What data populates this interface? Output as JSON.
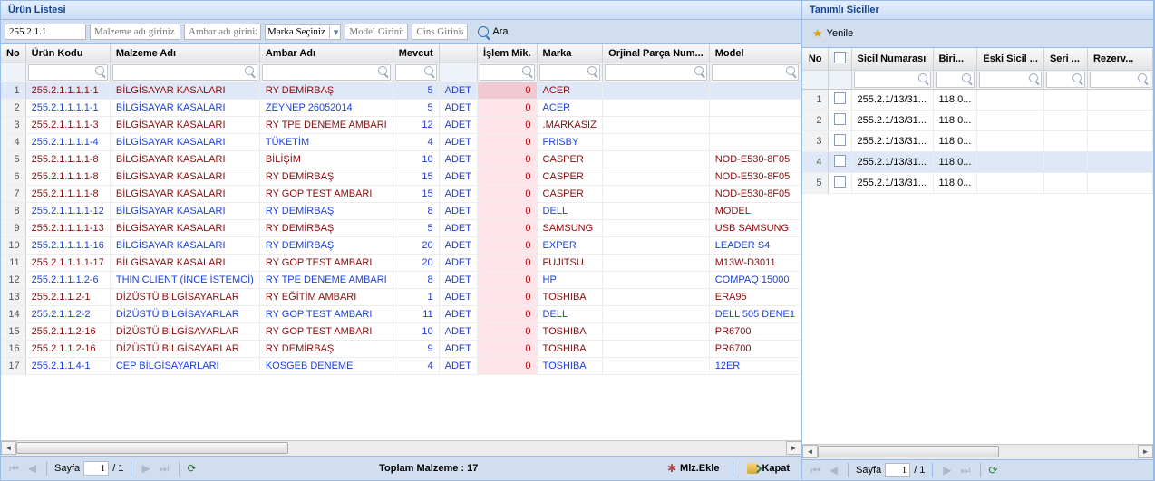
{
  "left": {
    "title": "Ürün Listesi",
    "search": {
      "kodu_value": "255.2.1.1",
      "malzeme_ph": "Malzeme adı giriniz",
      "ambar_ph": "Ambar adı giriniz",
      "marka_ph": "Marka Seçiniz",
      "model_ph": "Model Giriniz",
      "cins_ph": "Cins Giriniz",
      "ara": "Ara"
    },
    "cols": {
      "no": "No",
      "kodu": "Ürün Kodu",
      "malzeme": "Malzeme Adı",
      "ambar": "Ambar Adı",
      "mevcut": "Mevcut",
      "unit": "",
      "islem": "İşlem Mik.",
      "marka": "Marka",
      "orjinal": "Orjinal Parça Num...",
      "model": "Model"
    },
    "rows": [
      {
        "n": 1,
        "k": "255.2.1.1.1.1-1",
        "m": "BİLGİSAYAR KASALARI",
        "a": "RY DEMİRBAŞ",
        "q": 5,
        "u": "ADET",
        "i": 0,
        "marka": "ACER",
        "model": "",
        "sel": true,
        "dr": [
          "k",
          "m",
          "a",
          "marka"
        ]
      },
      {
        "n": 2,
        "k": "255.2.1.1.1.1-1",
        "m": "BİLGİSAYAR KASALARI",
        "a": "ZEYNEP 26052014",
        "q": 5,
        "u": "ADET",
        "i": 0,
        "marka": "ACER",
        "model": ""
      },
      {
        "n": 3,
        "k": "255.2.1.1.1.1-3",
        "m": "BİLGİSAYAR KASALARI",
        "a": "RY TPE DENEME AMBARI",
        "q": 12,
        "u": "ADET",
        "i": 0,
        "marka": ".MARKASIZ",
        "model": "",
        "dr": [
          "k",
          "m",
          "a",
          "marka"
        ]
      },
      {
        "n": 4,
        "k": "255.2.1.1.1.1-4",
        "m": "BİLGİSAYAR KASALARI",
        "a": "TÜKETİM",
        "q": 4,
        "u": "ADET",
        "i": 0,
        "marka": "FRISBY",
        "model": ""
      },
      {
        "n": 5,
        "k": "255.2.1.1.1.1-8",
        "m": "BİLGİSAYAR KASALARI",
        "a": "BİLİŞİM",
        "q": 10,
        "u": "ADET",
        "i": 0,
        "marka": "CASPER",
        "model": "NOD-E530-8F05",
        "dr": [
          "k",
          "m",
          "a",
          "marka",
          "model"
        ]
      },
      {
        "n": 6,
        "k": "255.2.1.1.1.1-8",
        "m": "BİLGİSAYAR KASALARI",
        "a": "RY DEMİRBAŞ",
        "q": 15,
        "u": "ADET",
        "i": 0,
        "marka": "CASPER",
        "model": "NOD-E530-8F05",
        "dr": [
          "k",
          "m",
          "a",
          "marka",
          "model"
        ]
      },
      {
        "n": 7,
        "k": "255.2.1.1.1.1-8",
        "m": "BİLGİSAYAR KASALARI",
        "a": "RY GOP TEST AMBARI",
        "q": 15,
        "u": "ADET",
        "i": 0,
        "marka": "CASPER",
        "model": "NOD-E530-8F05",
        "dr": [
          "k",
          "m",
          "a",
          "marka",
          "model"
        ]
      },
      {
        "n": 8,
        "k": "255.2.1.1.1.1-12",
        "m": "BİLGİSAYAR KASALARI",
        "a": "RY DEMİRBAŞ",
        "q": 8,
        "u": "ADET",
        "i": 0,
        "marka": "DELL",
        "model": "MODEL",
        "dr": [
          "model"
        ]
      },
      {
        "n": 9,
        "k": "255.2.1.1.1.1-13",
        "m": "BİLGİSAYAR KASALARI",
        "a": "RY DEMİRBAŞ",
        "q": 5,
        "u": "ADET",
        "i": 0,
        "marka": "SAMSUNG",
        "model": "USB SAMSUNG",
        "dr": [
          "k",
          "m",
          "a",
          "marka",
          "model"
        ]
      },
      {
        "n": 10,
        "k": "255.2.1.1.1.1-16",
        "m": "BİLGİSAYAR KASALARI",
        "a": "RY DEMİRBAŞ",
        "q": 20,
        "u": "ADET",
        "i": 0,
        "marka": "EXPER",
        "model": "LEADER S4"
      },
      {
        "n": 11,
        "k": "255.2.1.1.1.1-17",
        "m": "BİLGİSAYAR KASALARI",
        "a": "RY GOP TEST AMBARI",
        "q": 20,
        "u": "ADET",
        "i": 0,
        "marka": "FUJITSU",
        "model": "M13W-D3011",
        "dr": [
          "k",
          "m",
          "a",
          "marka",
          "model"
        ]
      },
      {
        "n": 12,
        "k": "255.2.1.1.1.2-6",
        "m": "THIN CLIENT (İNCE İSTEMCİ)",
        "a": "RY TPE DENEME AMBARI",
        "q": 8,
        "u": "ADET",
        "i": 0,
        "marka": "HP",
        "model": "COMPAQ 15000"
      },
      {
        "n": 13,
        "k": "255.2.1.1.2-1",
        "m": "DİZÜSTÜ BİLGİSAYARLAR",
        "a": "RY EĞİTİM AMBARI",
        "q": 1,
        "u": "ADET",
        "i": 0,
        "marka": "TOSHIBA",
        "model": "ERA95",
        "dr": [
          "k",
          "m",
          "a",
          "marka",
          "model"
        ]
      },
      {
        "n": 14,
        "k": "255.2.1.1.2-2",
        "m": "DİZÜSTÜ BİLGİSAYARLAR",
        "a": "RY GOP TEST AMBARI",
        "q": 11,
        "u": "ADET",
        "i": 0,
        "marka": "DELL",
        "model": "DELL 505 DENE1"
      },
      {
        "n": 15,
        "k": "255.2.1.1.2-16",
        "m": "DİZÜSTÜ BİLGİSAYARLAR",
        "a": "RY GOP TEST AMBARI",
        "q": 10,
        "u": "ADET",
        "i": 0,
        "marka": "TOSHIBA",
        "model": "PR6700",
        "dr": [
          "k",
          "m",
          "a",
          "marka",
          "model"
        ]
      },
      {
        "n": 16,
        "k": "255.2.1.1.2-16",
        "m": "DİZÜSTÜ BİLGİSAYARLAR",
        "a": "RY DEMİRBAŞ",
        "q": 9,
        "u": "ADET",
        "i": 0,
        "marka": "TOSHIBA",
        "model": "PR6700",
        "dr": [
          "k",
          "m",
          "a",
          "marka",
          "model"
        ]
      },
      {
        "n": 17,
        "k": "255.2.1.1.4-1",
        "m": "CEP BİLGİSAYARLARI",
        "a": "KOSGEB DENEME",
        "q": 4,
        "u": "ADET",
        "i": 0,
        "marka": "TOSHIBA",
        "model": "12ER"
      }
    ],
    "footer": {
      "sayfa": "Sayfa",
      "page": "1",
      "total": "/ 1",
      "toplam": "Toplam Malzeme : 17",
      "mlz": "Mlz.Ekle",
      "kapat": "Kapat"
    }
  },
  "right": {
    "title": "Tanımlı Siciller",
    "yenile": "Yenile",
    "cols": {
      "no": "No",
      "chk": "",
      "sicil": "Sicil Numarası",
      "birim": "Biri...",
      "eski": "Eski Sicil ...",
      "seri": "Seri ...",
      "rezerv": "Rezerv..."
    },
    "rows": [
      {
        "n": 1,
        "s": "255.2.1/13/31...",
        "b": "118.0..."
      },
      {
        "n": 2,
        "s": "255.2.1/13/31...",
        "b": "118.0..."
      },
      {
        "n": 3,
        "s": "255.2.1/13/31...",
        "b": "118.0..."
      },
      {
        "n": 4,
        "s": "255.2.1/13/31...",
        "b": "118.0...",
        "sel": true
      },
      {
        "n": 5,
        "s": "255.2.1/13/31...",
        "b": "118.0..."
      }
    ],
    "footer": {
      "sayfa": "Sayfa",
      "page": "1",
      "total": "/ 1"
    }
  }
}
